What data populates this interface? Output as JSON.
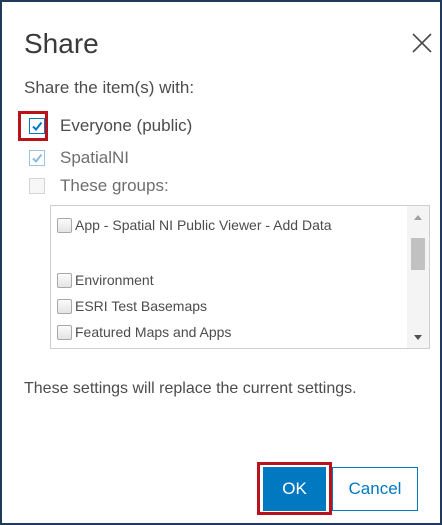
{
  "dialog": {
    "title": "Share",
    "close_icon": "close-icon",
    "instruction": "Share the item(s) with:"
  },
  "options": [
    {
      "label": "Everyone (public)",
      "checked": true,
      "state": "checked"
    },
    {
      "label": "SpatialNI",
      "checked": true,
      "state": "checked-disabled"
    },
    {
      "label": "These groups:",
      "checked": false,
      "state": "disabled"
    }
  ],
  "groups": {
    "items": [
      {
        "label": "App - Spatial NI Public Viewer - Add Data",
        "checked": false
      },
      {
        "label": "Environment",
        "checked": false
      },
      {
        "label": "ESRI Test Basemaps",
        "checked": false
      },
      {
        "label": "Featured Maps and Apps",
        "checked": false
      }
    ],
    "scroll_up_icon": "triangle-up-icon",
    "scroll_down_icon": "triangle-down-icon"
  },
  "info": {
    "text": "These settings will replace the current settings."
  },
  "buttons": {
    "ok_label": "OK",
    "cancel_label": "Cancel"
  },
  "colors": {
    "accent": "#0079c1",
    "highlight": "#b8131a",
    "border": "#1f3a5a"
  }
}
